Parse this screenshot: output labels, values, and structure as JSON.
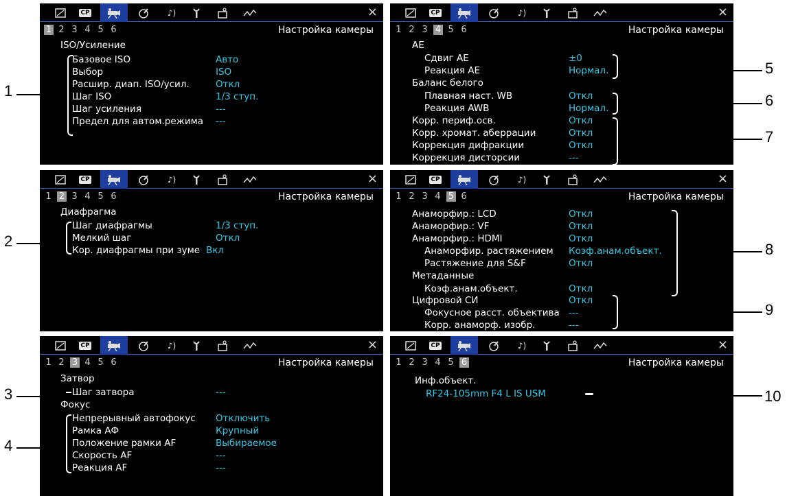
{
  "tabs": [
    "image-icon",
    "cp-icon",
    "camera-icon",
    "brush-icon",
    "audio-icon",
    "wrench-icon",
    "my-menu-icon",
    "waveform-icon"
  ],
  "tab_labels": {
    "cp": "CP",
    "close": "×"
  },
  "header": "Настройка камеры",
  "pages": [
    "1",
    "2",
    "3",
    "4",
    "5",
    "6"
  ],
  "screen1": {
    "section": "ISO/Усиление",
    "rows": [
      {
        "label": "Базовое ISO",
        "value": "Авто"
      },
      {
        "label": "Выбор",
        "value": "ISO"
      },
      {
        "label": "Расшир. диап. ISO/усил.",
        "value": "Откл"
      },
      {
        "label": "Шаг ISO",
        "value": "1/3 ступ."
      },
      {
        "label": "Шаг усиления",
        "value": "---"
      },
      {
        "label": "Предел для автом.режима",
        "value": "---"
      }
    ]
  },
  "screen2": {
    "section_ae": "AE",
    "ae_shift": {
      "label": "Сдвиг AE",
      "value": "±0"
    },
    "ae_response": {
      "label": "Реакция AE",
      "value": "Нормал."
    },
    "section_wb": "Баланс белого",
    "wb_smooth": {
      "label": "Плавная наст. WB",
      "value": "Откл"
    },
    "awb_response": {
      "label": "Реакция AWB",
      "value": "Нормал."
    },
    "periph": {
      "label": "Корр. периф.осв.",
      "value": "Откл"
    },
    "chrom": {
      "label": "Корр. хромат. аберрации",
      "value": "Откл"
    },
    "diffr": {
      "label": "Коррекция дифракции",
      "value": "Откл"
    },
    "distort": {
      "label": "Коррекция дисторсии",
      "value": "---"
    }
  },
  "screen3": {
    "section": "Диафрагма",
    "rows": [
      {
        "label": "Шаг диафрагмы",
        "value": "1/3 ступ."
      },
      {
        "label": "Мелкий шаг",
        "value": "Откл"
      },
      {
        "label": "Кор. диафрагмы при зуме",
        "value": "Вкл"
      }
    ]
  },
  "screen4": {
    "anam_lcd": {
      "label": "Анаморфир.: LCD",
      "value": "Откл"
    },
    "anam_vf": {
      "label": "Анаморфир.: VF",
      "value": "Откл"
    },
    "anam_hdmi": {
      "label": "Анаморфир.: HDMI",
      "value": "Откл"
    },
    "anam_stretch": {
      "label": "Анаморфир. растяжением",
      "value": "Коэф.анам.объект."
    },
    "sf_stretch": {
      "label": "Растяжение для S&F",
      "value": "Откл"
    },
    "section_meta": "Метаданные",
    "anam_coef": {
      "label": "Коэф.анам.объект.",
      "value": "Откл"
    },
    "digital_is": {
      "label": "Цифровой СИ",
      "value": "Откл"
    },
    "focal": {
      "label": "Фокусное расст. объектива",
      "value": "---"
    },
    "anam_corr": {
      "label": "Корр. анаморф. изобр.",
      "value": "---"
    }
  },
  "screen5": {
    "section_shutter": "Затвор",
    "shutter_step": {
      "label": "Шаг затвора",
      "value": "---"
    },
    "section_focus": "Фокус",
    "rows": [
      {
        "label": "Непрерывный автофокус",
        "value": "Отключить"
      },
      {
        "label": "Рамка АФ",
        "value": "Крупный"
      },
      {
        "label": "Положение рамки AF",
        "value": "Выбираемое"
      },
      {
        "label": "Скорость AF",
        "value": "---"
      },
      {
        "label": "Реакция AF",
        "value": "---"
      }
    ]
  },
  "screen6": {
    "section": "Инф.объект.",
    "lens": "RF24-105mm F4 L IS USM"
  },
  "callouts": [
    "1",
    "2",
    "3",
    "4",
    "5",
    "6",
    "7",
    "8",
    "9",
    "10"
  ],
  "colors": {
    "screen_bg": "#000000",
    "value": "#35c8e4",
    "active_tab": "#1f3fa0",
    "label": "#ffffff"
  }
}
